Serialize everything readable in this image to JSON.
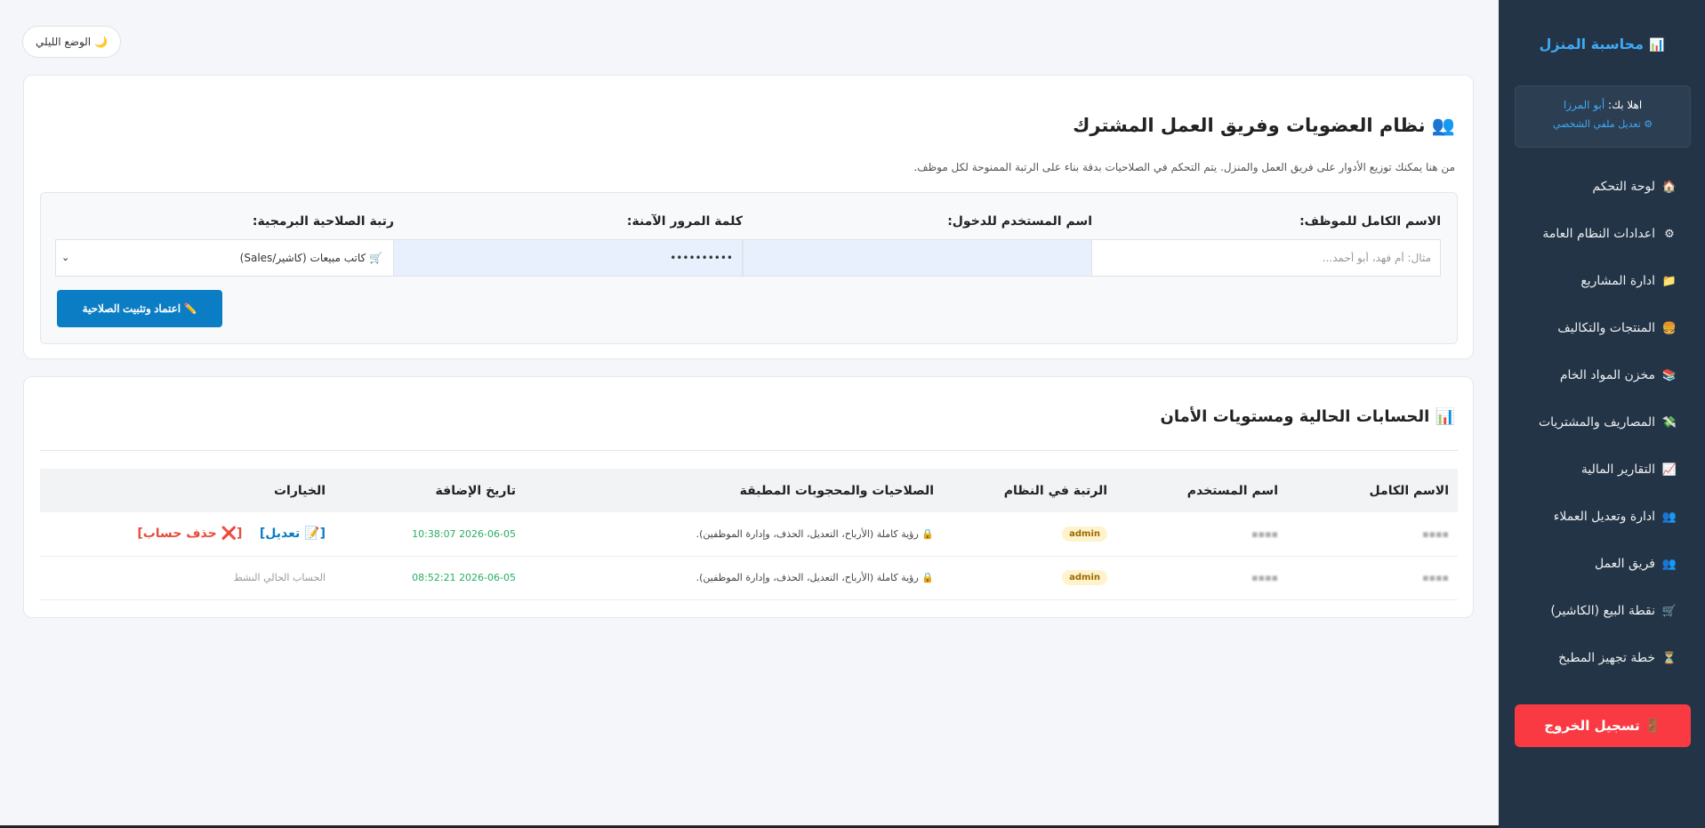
{
  "sidebar": {
    "brand": "محاسبة المنزل",
    "brand_icon": "chart-icon",
    "greeting_prefix": "اهلا بك:",
    "user_name": "أبو المرزا",
    "edit_profile": "⚙ تعديل ملفي الشخصي",
    "items": [
      {
        "icon": "🏠",
        "label": "لوحة التحكم"
      },
      {
        "icon": "⚙",
        "label": "اعدادات النظام العامة"
      },
      {
        "icon": "📁",
        "label": "ادارة المشاريع"
      },
      {
        "icon": "🍔",
        "label": "المنتجات والتكاليف"
      },
      {
        "icon": "📚",
        "label": "مخزن المواد الخام"
      },
      {
        "icon": "💸",
        "label": "المصاريف والمشتريات"
      },
      {
        "icon": "📈",
        "label": "التقارير المالية"
      },
      {
        "icon": "👥",
        "label": "ادارة وتعديل العملاء"
      },
      {
        "icon": "👥",
        "label": "فريق العمل"
      },
      {
        "icon": "🛒",
        "label": "نقطة البيع (الكاشير)"
      },
      {
        "icon": "⏳",
        "label": "خطة تجهيز المطبخ"
      }
    ],
    "logout": "🚪 تسجيل الخروج"
  },
  "top": {
    "dark_mode": "🌙 الوضع الليلي"
  },
  "membership": {
    "title": "👥 نظام العضويات وفريق العمل المشترك",
    "description": "من هنا يمكنك توزيع الأدوار على فريق العمل والمنزل. يتم التحكم في الصلاحيات بدقة بناء على الرتبة الممنوحة لكل موظف.",
    "fields": {
      "full_name_label": "الاسم الكامل للموظف:",
      "full_name_placeholder": "مثال: أم فهد، أبو أحمد...",
      "username_label": "اسم المستخدم للدخول:",
      "password_label": "كلمة المرور الآمنة:",
      "password_value": "••••••••••",
      "role_label": "رتبة الصلاحية البرمجية:",
      "role_value": "🛒 كاتب مبيعات (كاشير/Sales)"
    },
    "submit": "✏️ اعتماد وتثبيت الصلاحية"
  },
  "accounts": {
    "title": "📊 الحسابات الحالية ومستويات الأمان",
    "headers": [
      "الاسم الكامل",
      "اسم المستخدم",
      "الرتبة في النظام",
      "الصلاحيات والمحجوبات المطبقة",
      "تاريخ الإضافة",
      "الخيارات"
    ],
    "rows": [
      {
        "role": "admin",
        "permissions": "🔒 رؤية كاملة (الأرباح، التعديل، الحذف، وإدارة الموظفين).",
        "date": "2026-06-05 10:38:07",
        "edit": "[📝 تعديل]",
        "delete": "[❌ حذف حساب]"
      },
      {
        "role": "admin",
        "permissions": "🔒 رؤية كاملة (الأرباح، التعديل، الحذف، وإدارة الموظفين).",
        "date": "2026-06-05 08:52:21",
        "status": "الحساب الحالي النشط"
      }
    ]
  }
}
